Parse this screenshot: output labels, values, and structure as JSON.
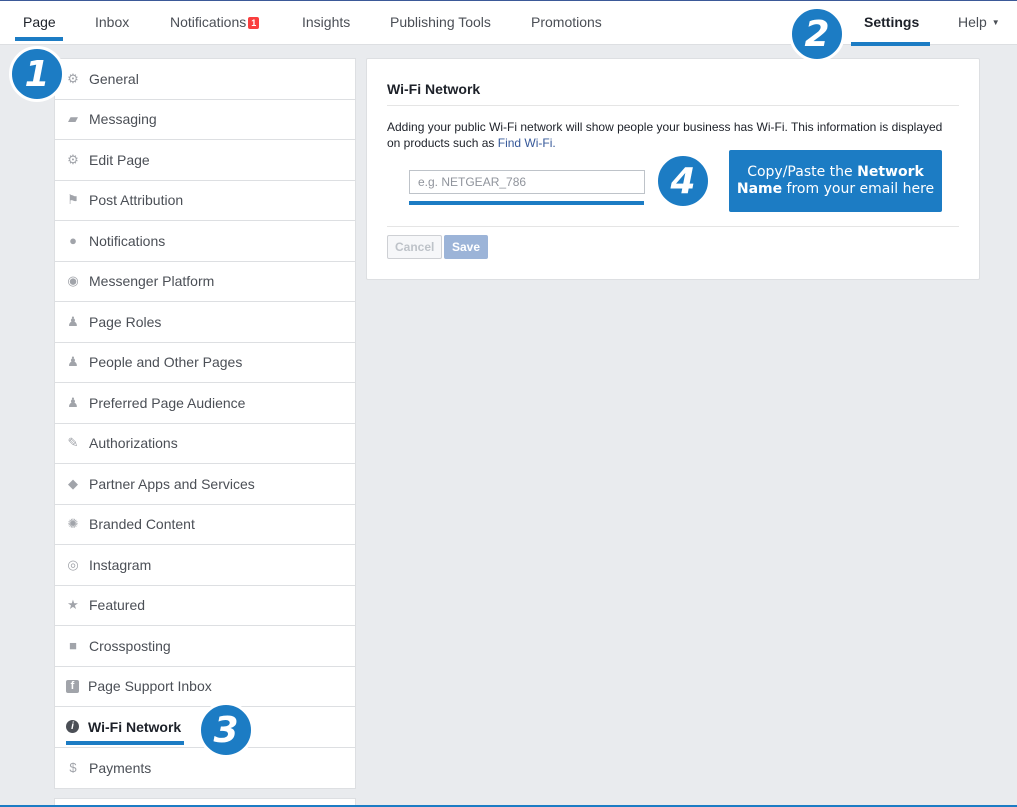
{
  "nav": {
    "tabs": [
      {
        "label": "Page"
      },
      {
        "label": "Inbox"
      },
      {
        "label": "Notifications",
        "badge": "1"
      },
      {
        "label": "Insights"
      },
      {
        "label": "Publishing Tools"
      },
      {
        "label": "Promotions"
      }
    ],
    "settings": "Settings",
    "help": "Help",
    "help_caret": "▼"
  },
  "steps": [
    "1",
    "2",
    "3",
    "4"
  ],
  "sidebar": {
    "items": [
      {
        "label": "General",
        "icon": "gear-icon",
        "glyph": "⚙"
      },
      {
        "label": "Messaging",
        "icon": "messaging-icon",
        "glyph": "▰"
      },
      {
        "label": "Edit Page",
        "icon": "gear-icon",
        "glyph": "⚙"
      },
      {
        "label": "Post Attribution",
        "icon": "flag-icon",
        "glyph": "⚑"
      },
      {
        "label": "Notifications",
        "icon": "globe-icon",
        "glyph": "●"
      },
      {
        "label": "Messenger Platform",
        "icon": "messenger-icon",
        "glyph": "◉"
      },
      {
        "label": "Page Roles",
        "icon": "person-icon",
        "glyph": "♟"
      },
      {
        "label": "People and Other Pages",
        "icon": "person-add-icon",
        "glyph": "♟"
      },
      {
        "label": "Preferred Page Audience",
        "icon": "person-add-icon",
        "glyph": "♟"
      },
      {
        "label": "Authorizations",
        "icon": "wrench-icon",
        "glyph": "✎"
      },
      {
        "label": "Partner Apps and Services",
        "icon": "cube-icon",
        "glyph": "◆"
      },
      {
        "label": "Branded Content",
        "icon": "handshake-icon",
        "glyph": "✺"
      },
      {
        "label": "Instagram",
        "icon": "instagram-icon",
        "glyph": "◎"
      },
      {
        "label": "Featured",
        "icon": "star-icon",
        "glyph": "★"
      },
      {
        "label": "Crossposting",
        "icon": "video-camera-icon",
        "glyph": "■"
      },
      {
        "label": "Page Support Inbox",
        "icon": "facebook-icon",
        "glyph": "f"
      },
      {
        "label": "Wi-Fi Network",
        "icon": "info-icon",
        "glyph": "i",
        "active": true
      },
      {
        "label": "Payments",
        "icon": "dollar-icon",
        "glyph": "$"
      }
    ]
  },
  "panel": {
    "title": "Wi-Fi Network",
    "description": "Adding your public Wi-Fi network will show people your business has Wi-Fi. This information is displayed on products such as ",
    "link": "Find Wi-Fi.",
    "input_placeholder": "e.g. NETGEAR_786",
    "input_value": "",
    "callout_line1_normal": "Copy/Paste the ",
    "callout_line1_bold": "Network",
    "callout_line2_bold": "Name",
    "callout_line2_normal": " from your email here",
    "cancel_label": "Cancel",
    "save_label": "Save"
  },
  "colors": {
    "accent": "#1c7cc4",
    "badge": "#fa3e3e",
    "link": "#365899",
    "save_disabled": "#9cb4d8"
  }
}
